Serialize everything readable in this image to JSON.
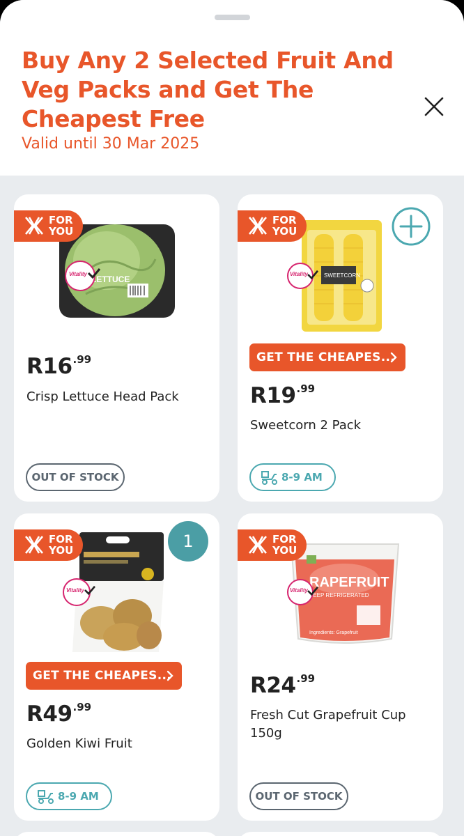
{
  "header": {
    "title": "Buy Any 2 Selected Fruit And Veg Packs and Get The Cheapest Free",
    "valid": "Valid until 30 Mar 2025"
  },
  "badge": {
    "for": "FOR",
    "you": "YOU"
  },
  "colors": {
    "accent": "#e8562a",
    "teal": "#4ba8b0",
    "background": "#e9ecef",
    "vitality": "#d6246e"
  },
  "products": [
    {
      "name": "Crisp Lettuce Head Pack",
      "price_rand": "R16",
      "price_cents": ".99",
      "status": "OUT OF STOCK",
      "vitality": "Vitality"
    },
    {
      "name": "Sweetcorn 2 Pack",
      "price_rand": "R19",
      "price_cents": ".99",
      "promo": "GET THE CHEAPES...",
      "delivery": "8-9 AM",
      "vitality": "Vitality"
    },
    {
      "name": "Golden Kiwi Fruit",
      "price_rand": "R49",
      "price_cents": ".99",
      "promo": "GET THE CHEAPES...",
      "delivery": "8-9 AM",
      "quantity": "1",
      "vitality": "Vitality"
    },
    {
      "name": "Fresh Cut Grapefruit Cup 150g",
      "price_rand": "R24",
      "price_cents": ".99",
      "status": "OUT OF STOCK",
      "vitality": "Vitality"
    }
  ],
  "icons": {
    "close": "close-icon",
    "add": "plus-icon",
    "delivery": "delivery-scooter-icon",
    "chevron": "chevron-right-icon",
    "brand": "x-for-you-icon"
  }
}
